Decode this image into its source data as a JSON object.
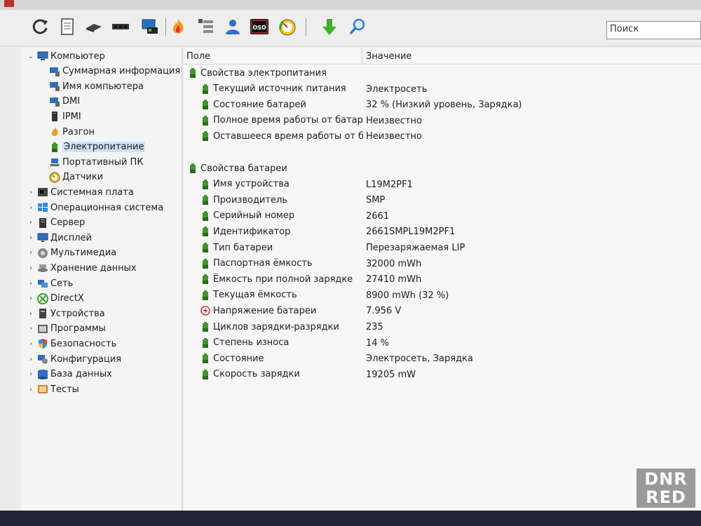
{
  "toolbar": {
    "buttons": [
      {
        "name": "refresh-icon",
        "icon": "circular-arrow"
      },
      {
        "name": "report-icon",
        "icon": "document"
      },
      {
        "name": "motherboard-icon",
        "icon": "chip"
      },
      {
        "name": "memory-icon",
        "icon": "ram-module"
      },
      {
        "name": "display-icon",
        "icon": "monitor-with-card"
      },
      {
        "name": "overclock-icon",
        "icon": "flame"
      },
      {
        "name": "device-list-icon",
        "icon": "list-with-tree"
      },
      {
        "name": "user-icon",
        "icon": "person"
      },
      {
        "name": "osd-icon",
        "icon": "osd-badge",
        "label": "OSD"
      },
      {
        "name": "gauge-icon",
        "icon": "speedometer"
      },
      {
        "name": "download-icon",
        "icon": "green-down-arrow"
      },
      {
        "name": "search-icon",
        "icon": "magnifier"
      }
    ],
    "search_placeholder": "Поиск"
  },
  "tree": {
    "items": [
      {
        "level": 0,
        "arrow": "open",
        "icon": "computer-icon",
        "label": "Компьютер"
      },
      {
        "level": 1,
        "arrow": "",
        "icon": "summary-icon",
        "label": "Суммарная информация"
      },
      {
        "level": 1,
        "arrow": "",
        "icon": "computer-name-icon",
        "label": "Имя компьютера"
      },
      {
        "level": 1,
        "arrow": "",
        "icon": "dmi-icon",
        "label": "DMI"
      },
      {
        "level": 1,
        "arrow": "",
        "icon": "ipmi-icon",
        "label": "IPMI"
      },
      {
        "level": 1,
        "arrow": "",
        "icon": "overclock-icon",
        "label": "Разгон"
      },
      {
        "level": 1,
        "arrow": "",
        "icon": "battery-icon",
        "label": "Электропитание",
        "selected": true
      },
      {
        "level": 1,
        "arrow": "",
        "icon": "laptop-icon",
        "label": "Портативный ПК"
      },
      {
        "level": 1,
        "arrow": "",
        "icon": "sensor-icon",
        "label": "Датчики"
      },
      {
        "level": 0,
        "arrow": "closed",
        "icon": "motherboard-icon",
        "label": "Системная плата"
      },
      {
        "level": 0,
        "arrow": "closed",
        "icon": "windows-icon",
        "label": "Операционная система"
      },
      {
        "level": 0,
        "arrow": "closed",
        "icon": "server-icon",
        "label": "Сервер"
      },
      {
        "level": 0,
        "arrow": "closed",
        "icon": "display-icon",
        "label": "Дисплей"
      },
      {
        "level": 0,
        "arrow": "closed",
        "icon": "multimedia-icon",
        "label": "Мультимедиа"
      },
      {
        "level": 0,
        "arrow": "closed",
        "icon": "storage-icon",
        "label": "Хранение данных"
      },
      {
        "level": 0,
        "arrow": "closed",
        "icon": "network-icon",
        "label": "Сеть"
      },
      {
        "level": 0,
        "arrow": "closed",
        "icon": "directx-icon",
        "label": "DirectX"
      },
      {
        "level": 0,
        "arrow": "closed",
        "icon": "devices-icon",
        "label": "Устройства"
      },
      {
        "level": 0,
        "arrow": "closed",
        "icon": "programs-icon",
        "label": "Программы"
      },
      {
        "level": 0,
        "arrow": "closed",
        "icon": "security-icon",
        "label": "Безопасность"
      },
      {
        "level": 0,
        "arrow": "closed",
        "icon": "config-icon",
        "label": "Конфигурация"
      },
      {
        "level": 0,
        "arrow": "closed",
        "icon": "database-icon",
        "label": "База данных"
      },
      {
        "level": 0,
        "arrow": "closed",
        "icon": "tests-icon",
        "label": "Тесты"
      }
    ]
  },
  "list": {
    "columns": {
      "field": "Поле",
      "value": "Значение"
    },
    "groups": [
      {
        "title": "Свойства электропитания",
        "rows": [
          {
            "icon": "battery-icon",
            "field": "Текущий источник питания",
            "value": "Электросеть"
          },
          {
            "icon": "battery-icon",
            "field": "Состояние батарей",
            "value": "32 % (Низкий уровень, Зарядка)"
          },
          {
            "icon": "battery-icon",
            "field": "Полное время работы от батар...",
            "value": "Неизвестно"
          },
          {
            "icon": "battery-icon",
            "field": "Оставшееся время работы от б...",
            "value": "Неизвестно"
          }
        ]
      },
      {
        "title": "Свойства батареи",
        "rows": [
          {
            "icon": "battery-icon",
            "field": "Имя устройства",
            "value": "L19M2PF1"
          },
          {
            "icon": "battery-icon",
            "field": "Производитель",
            "value": "SMP"
          },
          {
            "icon": "battery-icon",
            "field": "Серийный номер",
            "value": "2661"
          },
          {
            "icon": "battery-icon",
            "field": "Идентификатор",
            "value": "2661SMPL19M2PF1"
          },
          {
            "icon": "battery-icon",
            "field": "Тип батареи",
            "value": "Перезаряжаемая LIP"
          },
          {
            "icon": "battery-icon",
            "field": "Паспортная ёмкость",
            "value": "32000 mWh"
          },
          {
            "icon": "battery-icon",
            "field": "Ёмкость при полной зарядке",
            "value": "27410 mWh"
          },
          {
            "icon": "battery-icon",
            "field": "Текущая ёмкость",
            "value": "8900 mWh  (32 %)"
          },
          {
            "icon": "voltage-icon",
            "field": "Напряжение батареи",
            "value": "7.956 V"
          },
          {
            "icon": "battery-icon",
            "field": "Циклов зарядки-разрядки",
            "value": "235"
          },
          {
            "icon": "battery-icon",
            "field": "Степень износа",
            "value": "14 %"
          },
          {
            "icon": "battery-icon",
            "field": "Состояние",
            "value": "Электросеть, Зарядка"
          },
          {
            "icon": "battery-icon",
            "field": "Скорость зарядки",
            "value": "19205 mW"
          }
        ]
      }
    ]
  },
  "watermark": {
    "text": "DNR RED"
  },
  "colors": {
    "battery_green": "#3a9a2a",
    "computer_blue": "#2f6fc4",
    "selection": "#cfe3f7"
  }
}
